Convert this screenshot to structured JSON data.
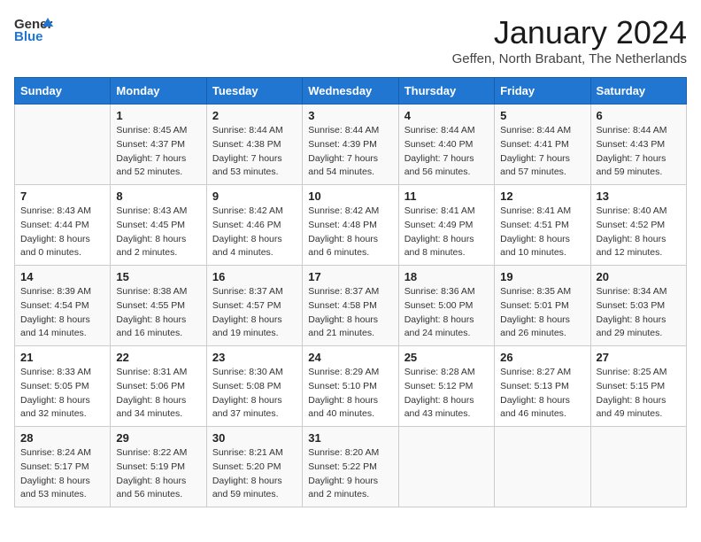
{
  "header": {
    "logo_general": "General",
    "logo_blue": "Blue",
    "month_title": "January 2024",
    "location": "Geffen, North Brabant, The Netherlands"
  },
  "columns": [
    "Sunday",
    "Monday",
    "Tuesday",
    "Wednesday",
    "Thursday",
    "Friday",
    "Saturday"
  ],
  "weeks": [
    [
      {
        "day": "",
        "content": ""
      },
      {
        "day": "1",
        "content": "Sunrise: 8:45 AM\nSunset: 4:37 PM\nDaylight: 7 hours\nand 52 minutes."
      },
      {
        "day": "2",
        "content": "Sunrise: 8:44 AM\nSunset: 4:38 PM\nDaylight: 7 hours\nand 53 minutes."
      },
      {
        "day": "3",
        "content": "Sunrise: 8:44 AM\nSunset: 4:39 PM\nDaylight: 7 hours\nand 54 minutes."
      },
      {
        "day": "4",
        "content": "Sunrise: 8:44 AM\nSunset: 4:40 PM\nDaylight: 7 hours\nand 56 minutes."
      },
      {
        "day": "5",
        "content": "Sunrise: 8:44 AM\nSunset: 4:41 PM\nDaylight: 7 hours\nand 57 minutes."
      },
      {
        "day": "6",
        "content": "Sunrise: 8:44 AM\nSunset: 4:43 PM\nDaylight: 7 hours\nand 59 minutes."
      }
    ],
    [
      {
        "day": "7",
        "content": "Sunrise: 8:43 AM\nSunset: 4:44 PM\nDaylight: 8 hours\nand 0 minutes."
      },
      {
        "day": "8",
        "content": "Sunrise: 8:43 AM\nSunset: 4:45 PM\nDaylight: 8 hours\nand 2 minutes."
      },
      {
        "day": "9",
        "content": "Sunrise: 8:42 AM\nSunset: 4:46 PM\nDaylight: 8 hours\nand 4 minutes."
      },
      {
        "day": "10",
        "content": "Sunrise: 8:42 AM\nSunset: 4:48 PM\nDaylight: 8 hours\nand 6 minutes."
      },
      {
        "day": "11",
        "content": "Sunrise: 8:41 AM\nSunset: 4:49 PM\nDaylight: 8 hours\nand 8 minutes."
      },
      {
        "day": "12",
        "content": "Sunrise: 8:41 AM\nSunset: 4:51 PM\nDaylight: 8 hours\nand 10 minutes."
      },
      {
        "day": "13",
        "content": "Sunrise: 8:40 AM\nSunset: 4:52 PM\nDaylight: 8 hours\nand 12 minutes."
      }
    ],
    [
      {
        "day": "14",
        "content": "Sunrise: 8:39 AM\nSunset: 4:54 PM\nDaylight: 8 hours\nand 14 minutes."
      },
      {
        "day": "15",
        "content": "Sunrise: 8:38 AM\nSunset: 4:55 PM\nDaylight: 8 hours\nand 16 minutes."
      },
      {
        "day": "16",
        "content": "Sunrise: 8:37 AM\nSunset: 4:57 PM\nDaylight: 8 hours\nand 19 minutes."
      },
      {
        "day": "17",
        "content": "Sunrise: 8:37 AM\nSunset: 4:58 PM\nDaylight: 8 hours\nand 21 minutes."
      },
      {
        "day": "18",
        "content": "Sunrise: 8:36 AM\nSunset: 5:00 PM\nDaylight: 8 hours\nand 24 minutes."
      },
      {
        "day": "19",
        "content": "Sunrise: 8:35 AM\nSunset: 5:01 PM\nDaylight: 8 hours\nand 26 minutes."
      },
      {
        "day": "20",
        "content": "Sunrise: 8:34 AM\nSunset: 5:03 PM\nDaylight: 8 hours\nand 29 minutes."
      }
    ],
    [
      {
        "day": "21",
        "content": "Sunrise: 8:33 AM\nSunset: 5:05 PM\nDaylight: 8 hours\nand 32 minutes."
      },
      {
        "day": "22",
        "content": "Sunrise: 8:31 AM\nSunset: 5:06 PM\nDaylight: 8 hours\nand 34 minutes."
      },
      {
        "day": "23",
        "content": "Sunrise: 8:30 AM\nSunset: 5:08 PM\nDaylight: 8 hours\nand 37 minutes."
      },
      {
        "day": "24",
        "content": "Sunrise: 8:29 AM\nSunset: 5:10 PM\nDaylight: 8 hours\nand 40 minutes."
      },
      {
        "day": "25",
        "content": "Sunrise: 8:28 AM\nSunset: 5:12 PM\nDaylight: 8 hours\nand 43 minutes."
      },
      {
        "day": "26",
        "content": "Sunrise: 8:27 AM\nSunset: 5:13 PM\nDaylight: 8 hours\nand 46 minutes."
      },
      {
        "day": "27",
        "content": "Sunrise: 8:25 AM\nSunset: 5:15 PM\nDaylight: 8 hours\nand 49 minutes."
      }
    ],
    [
      {
        "day": "28",
        "content": "Sunrise: 8:24 AM\nSunset: 5:17 PM\nDaylight: 8 hours\nand 53 minutes."
      },
      {
        "day": "29",
        "content": "Sunrise: 8:22 AM\nSunset: 5:19 PM\nDaylight: 8 hours\nand 56 minutes."
      },
      {
        "day": "30",
        "content": "Sunrise: 8:21 AM\nSunset: 5:20 PM\nDaylight: 8 hours\nand 59 minutes."
      },
      {
        "day": "31",
        "content": "Sunrise: 8:20 AM\nSunset: 5:22 PM\nDaylight: 9 hours\nand 2 minutes."
      },
      {
        "day": "",
        "content": ""
      },
      {
        "day": "",
        "content": ""
      },
      {
        "day": "",
        "content": ""
      }
    ]
  ]
}
